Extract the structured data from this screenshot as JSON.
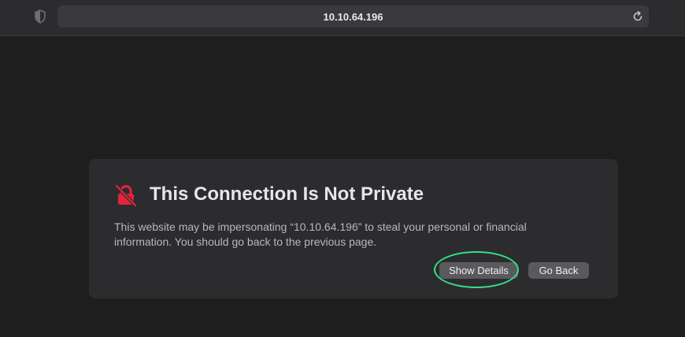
{
  "browser": {
    "address": "10.10.64.196",
    "shield_icon": "privacy-shield-icon",
    "reload_icon": "reload-icon"
  },
  "warning": {
    "icon": "insecure-lock-icon",
    "icon_color": "#e0253d",
    "title": "This Connection Is Not Private",
    "message": "This website may be impersonating “10.10.64.196” to steal your personal or financial information. You should go back to the previous page."
  },
  "buttons": {
    "show_details": "Show Details",
    "go_back": "Go Back"
  },
  "annotation": {
    "highlight_color": "#33e387"
  }
}
